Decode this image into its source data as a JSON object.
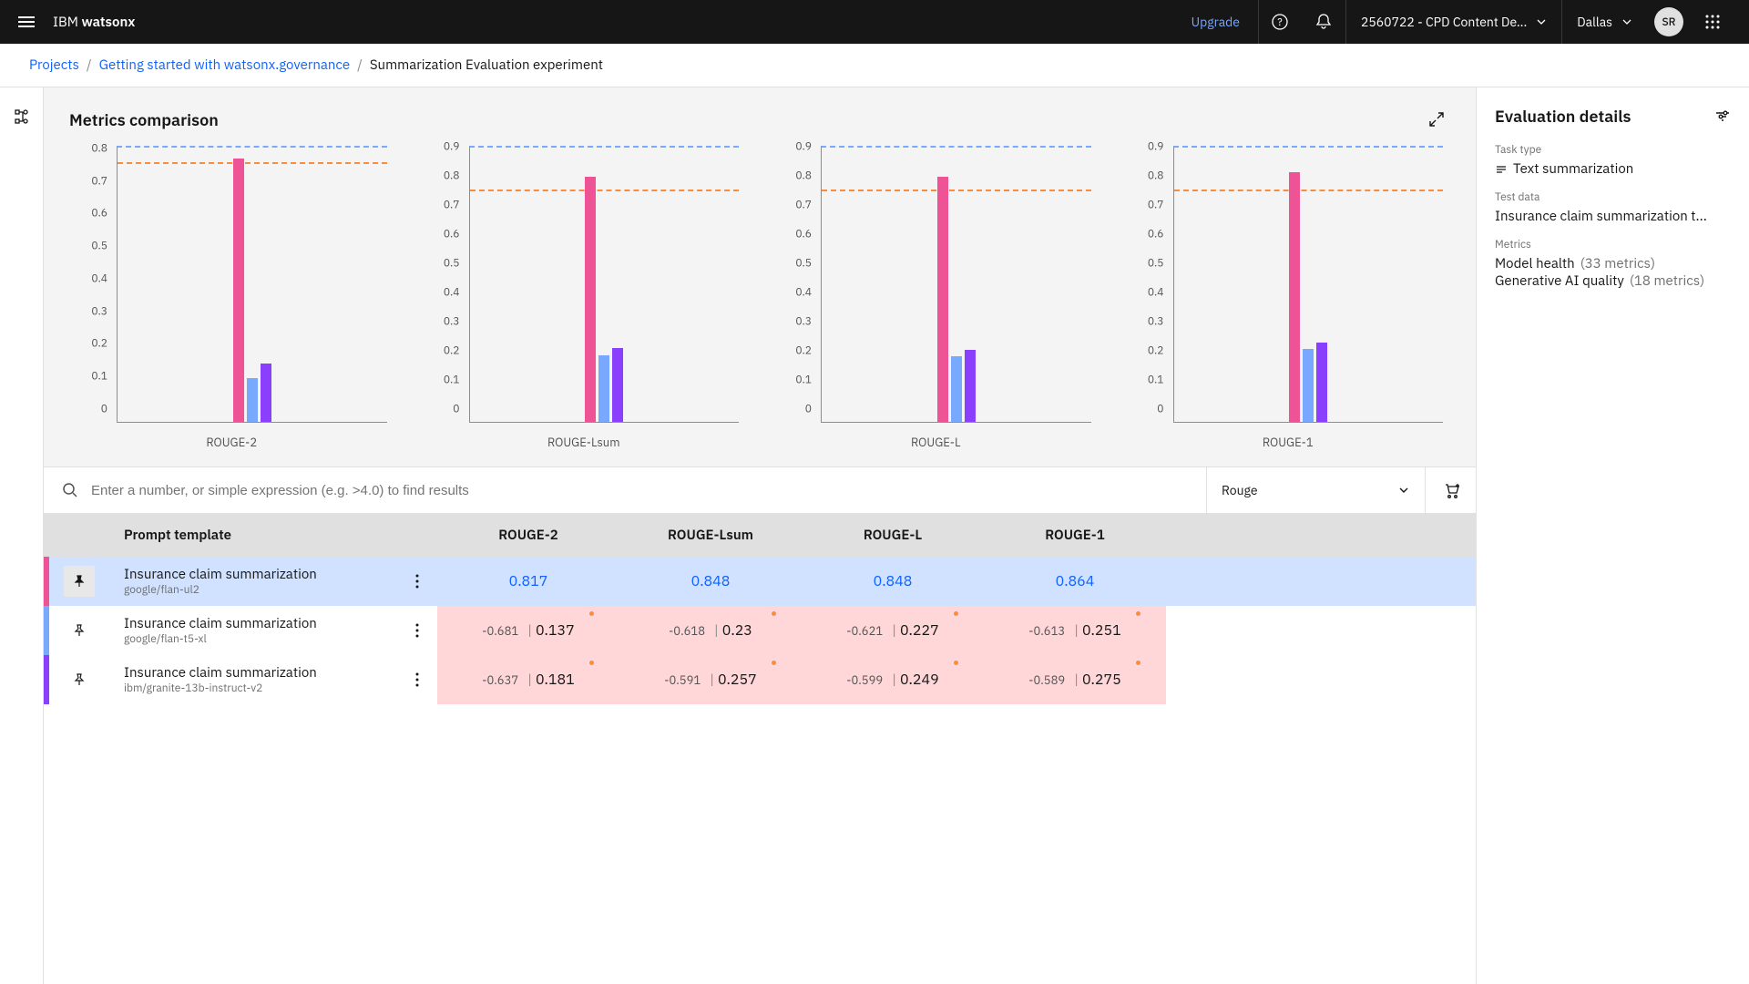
{
  "header": {
    "brand_prefix": "IBM ",
    "brand_bold": "watsonx",
    "upgrade": "Upgrade",
    "workspace": "2560722 - CPD Content De...",
    "region": "Dallas",
    "avatar": "SR"
  },
  "breadcrumb": {
    "items": [
      "Projects",
      "Getting started with watsonx.governance"
    ],
    "current": "Summarization Evaluation experiment"
  },
  "section": {
    "title": "Metrics comparison"
  },
  "chart_data": [
    {
      "type": "bar",
      "xlabel": "ROUGE-2",
      "ylim": [
        0,
        0.85
      ],
      "threshold": 0.8,
      "yticks": [
        0,
        0.1,
        0.2,
        0.3,
        0.4,
        0.5,
        0.6,
        0.7,
        0.8
      ],
      "series": [
        {
          "name": "google/flan-ul2",
          "color": "#ee5396",
          "value": 0.817
        },
        {
          "name": "google/flan-t5-xl",
          "color": "#78a9ff",
          "value": 0.137
        },
        {
          "name": "ibm/granite-13b-instruct-v2",
          "color": "#8a3ffc",
          "value": 0.181
        }
      ]
    },
    {
      "type": "bar",
      "xlabel": "ROUGE-Lsum",
      "ylim": [
        0,
        0.95
      ],
      "threshold": 0.8,
      "yticks": [
        0,
        0.1,
        0.2,
        0.3,
        0.4,
        0.5,
        0.6,
        0.7,
        0.8,
        0.9
      ],
      "series": [
        {
          "name": "google/flan-ul2",
          "color": "#ee5396",
          "value": 0.848
        },
        {
          "name": "google/flan-t5-xl",
          "color": "#78a9ff",
          "value": 0.23
        },
        {
          "name": "ibm/granite-13b-instruct-v2",
          "color": "#8a3ffc",
          "value": 0.257
        }
      ]
    },
    {
      "type": "bar",
      "xlabel": "ROUGE-L",
      "ylim": [
        0,
        0.95
      ],
      "threshold": 0.8,
      "yticks": [
        0,
        0.1,
        0.2,
        0.3,
        0.4,
        0.5,
        0.6,
        0.7,
        0.8,
        0.9
      ],
      "series": [
        {
          "name": "google/flan-ul2",
          "color": "#ee5396",
          "value": 0.848
        },
        {
          "name": "google/flan-t5-xl",
          "color": "#78a9ff",
          "value": 0.227
        },
        {
          "name": "ibm/granite-13b-instruct-v2",
          "color": "#8a3ffc",
          "value": 0.249
        }
      ]
    },
    {
      "type": "bar",
      "xlabel": "ROUGE-1",
      "ylim": [
        0,
        0.95
      ],
      "threshold": 0.8,
      "yticks": [
        0,
        0.1,
        0.2,
        0.3,
        0.4,
        0.5,
        0.6,
        0.7,
        0.8,
        0.9
      ],
      "series": [
        {
          "name": "google/flan-ul2",
          "color": "#ee5396",
          "value": 0.864
        },
        {
          "name": "google/flan-t5-xl",
          "color": "#78a9ff",
          "value": 0.251
        },
        {
          "name": "ibm/granite-13b-instruct-v2",
          "color": "#8a3ffc",
          "value": 0.275
        }
      ]
    }
  ],
  "search": {
    "placeholder": "Enter a number, or simple expression (e.g. >4.0) to find results"
  },
  "dropdown": {
    "selected": "Rouge"
  },
  "table": {
    "headers": [
      "Prompt template",
      "ROUGE-2",
      "ROUGE-Lsum",
      "ROUGE-L",
      "ROUGE-1"
    ],
    "rows": [
      {
        "pinned": true,
        "stripe": "#ee5396",
        "name": "Insurance claim summarization",
        "model": "google/flan-ul2",
        "cells": [
          {
            "val": "0.817"
          },
          {
            "val": "0.848"
          },
          {
            "val": "0.848"
          },
          {
            "val": "0.864"
          }
        ]
      },
      {
        "pinned": false,
        "neg": true,
        "stripe": "#78a9ff",
        "name": "Insurance claim summarization",
        "model": "google/flan-t5-xl",
        "cells": [
          {
            "delta": "-0.681",
            "val": "0.137"
          },
          {
            "delta": "-0.618",
            "val": "0.23"
          },
          {
            "delta": "-0.621",
            "val": "0.227"
          },
          {
            "delta": "-0.613",
            "val": "0.251"
          }
        ]
      },
      {
        "pinned": false,
        "neg": true,
        "stripe": "#8a3ffc",
        "name": "Insurance claim summarization",
        "model": "ibm/granite-13b-instruct-v2",
        "cells": [
          {
            "delta": "-0.637",
            "val": "0.181"
          },
          {
            "delta": "-0.591",
            "val": "0.257"
          },
          {
            "delta": "-0.599",
            "val": "0.249"
          },
          {
            "delta": "-0.589",
            "val": "0.275"
          }
        ]
      }
    ]
  },
  "details": {
    "title": "Evaluation details",
    "task_type_label": "Task type",
    "task_type": "Text summarization",
    "test_data_label": "Test data",
    "test_data": "Insurance claim summarization t...",
    "metrics_label": "Metrics",
    "metrics": [
      {
        "name": "Model health",
        "count": "(33 metrics)"
      },
      {
        "name": "Generative AI quality",
        "count": "(18 metrics)"
      }
    ]
  }
}
